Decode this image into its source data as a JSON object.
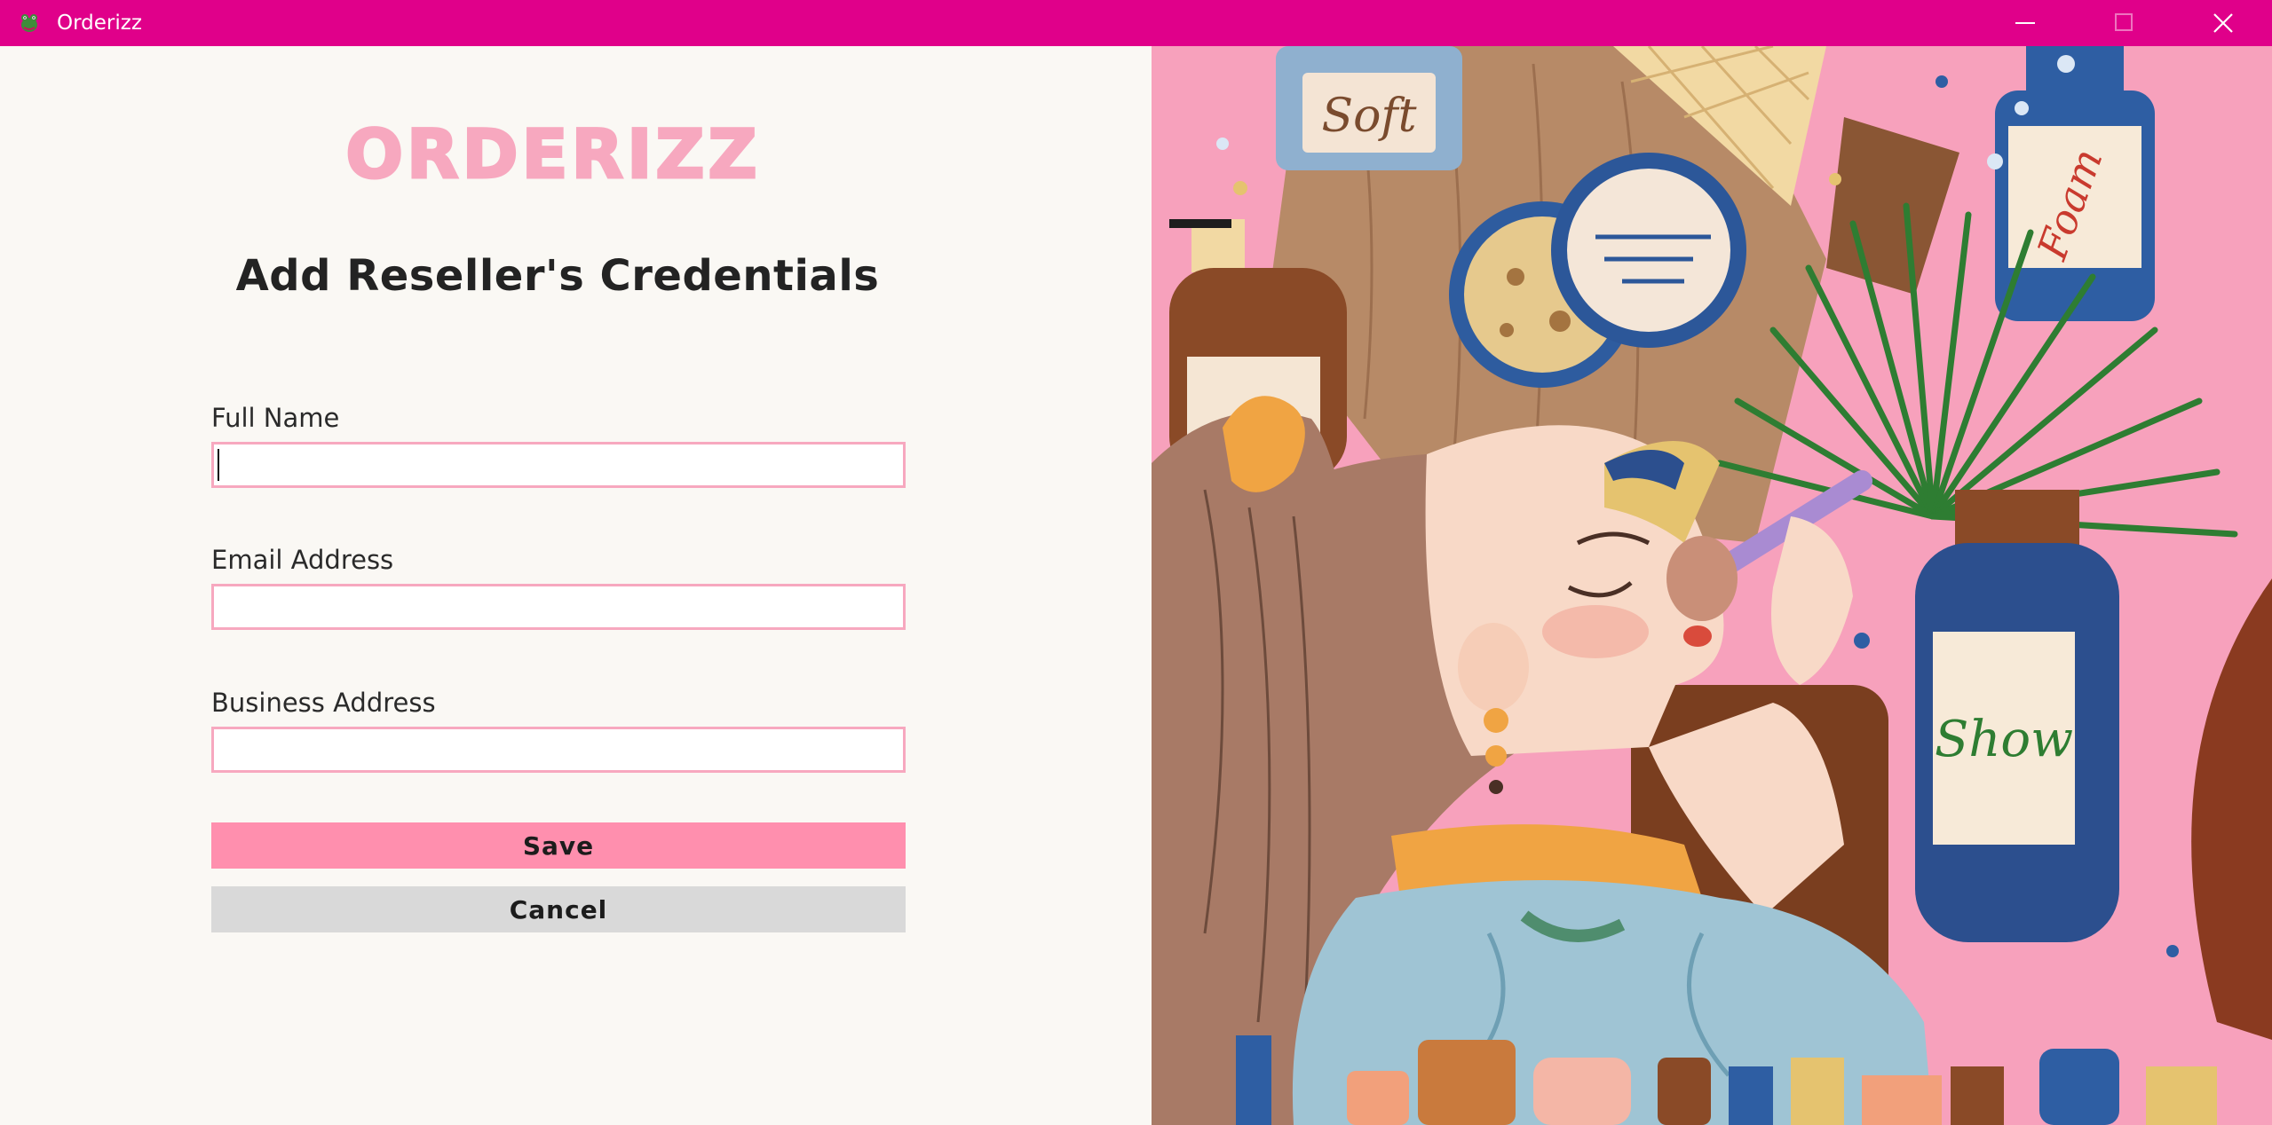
{
  "window": {
    "title": "Orderizz",
    "icon": "orderizz-app-icon",
    "controls": [
      "minimize-icon",
      "maximize-icon",
      "close-icon"
    ]
  },
  "logo": {
    "text": "ORDERIZZ",
    "color": "#f7a8bf"
  },
  "form": {
    "title": "Add Reseller's Credentials",
    "fields": {
      "full_name": {
        "label": "Full Name",
        "value": "",
        "placeholder": ""
      },
      "email": {
        "label": "Email Address",
        "value": "",
        "placeholder": ""
      },
      "business_address": {
        "label": "Business Address",
        "value": "",
        "placeholder": ""
      }
    },
    "save_label": "Save",
    "cancel_label": "Cancel"
  },
  "illustration": {
    "description_icon": "cosmetics-illustration",
    "product_labels": [
      "Soft",
      "Foam",
      "Show"
    ]
  },
  "colors": {
    "titlebar": "#e0008a",
    "save_button": "#ff8fae",
    "cancel_button": "#d9d9d9",
    "input_border": "#f7a8bf",
    "background": "#faf8f4"
  }
}
